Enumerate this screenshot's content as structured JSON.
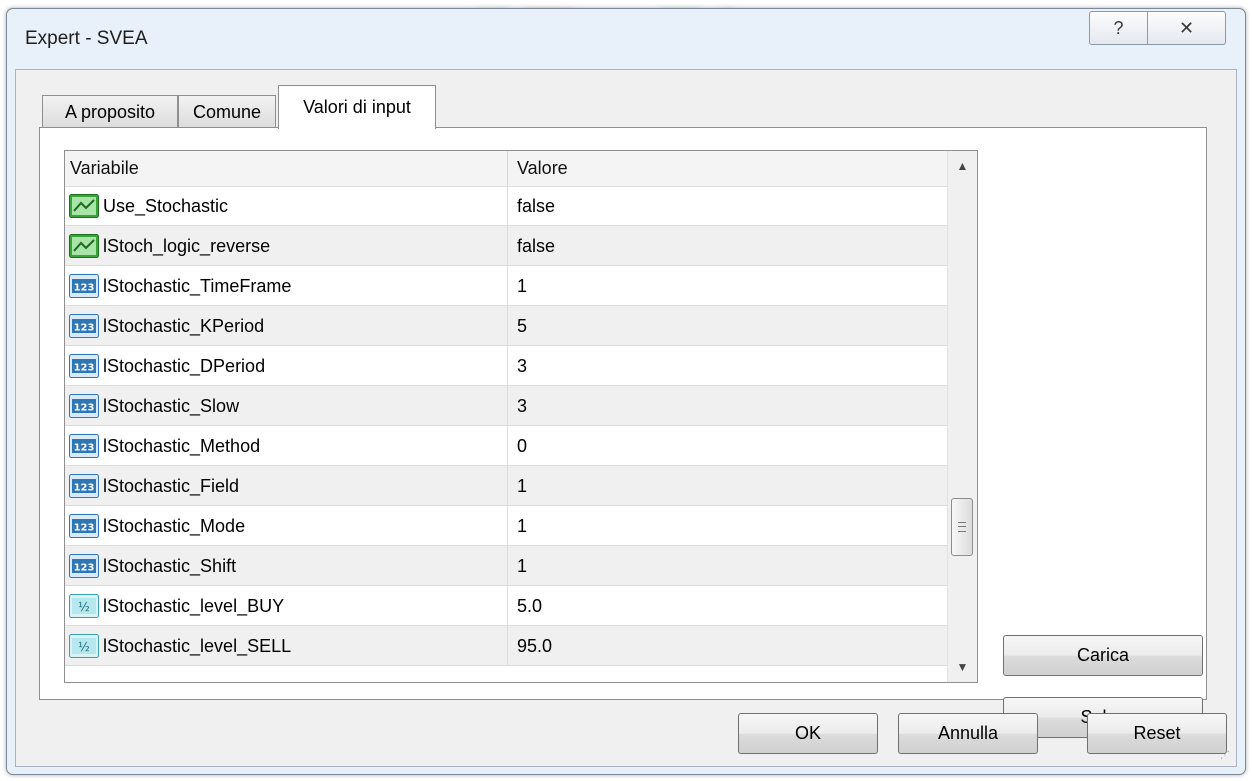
{
  "dialog": {
    "title": "Expert - SVEA",
    "help_glyph": "?",
    "close_glyph": "✕"
  },
  "tabs": [
    {
      "label": "A proposito",
      "active": false
    },
    {
      "label": "Comune",
      "active": false
    },
    {
      "label": "Valori di input",
      "active": true
    }
  ],
  "table": {
    "columns": [
      "Variabile",
      "Valore"
    ],
    "rows": [
      {
        "icon": "boolean-icon",
        "name": "Use_Stochastic",
        "value": "false"
      },
      {
        "icon": "boolean-icon",
        "name": "lStoch_logic_reverse",
        "value": "false"
      },
      {
        "icon": "integer-icon",
        "name": "lStochastic_TimeFrame",
        "value": "1"
      },
      {
        "icon": "integer-icon",
        "name": "lStochastic_KPeriod",
        "value": "5"
      },
      {
        "icon": "integer-icon",
        "name": "lStochastic_DPeriod",
        "value": "3"
      },
      {
        "icon": "integer-icon",
        "name": "lStochastic_Slow",
        "value": "3"
      },
      {
        "icon": "integer-icon",
        "name": "lStochastic_Method",
        "value": "0"
      },
      {
        "icon": "integer-icon",
        "name": "lStochastic_Field",
        "value": "1"
      },
      {
        "icon": "integer-icon",
        "name": "lStochastic_Mode",
        "value": "1"
      },
      {
        "icon": "integer-icon",
        "name": "lStochastic_Shift",
        "value": "1"
      },
      {
        "icon": "double-icon",
        "name": "lStochastic_level_BUY",
        "value": "5.0"
      },
      {
        "icon": "double-icon",
        "name": "lStochastic_level_SELL",
        "value": "95.0"
      }
    ]
  },
  "side_buttons": {
    "load": "Carica",
    "save": "Salva"
  },
  "footer_buttons": {
    "ok": "OK",
    "cancel": "Annulla",
    "reset": "Reset"
  },
  "icon_labels": {
    "integer": "123",
    "double": "½"
  },
  "colors": {
    "dialog_frame": "#e8f0f9",
    "boolean_icon": "#3aa43a",
    "integer_icon": "#2f77b4",
    "double_icon": "#3aa0b0"
  }
}
